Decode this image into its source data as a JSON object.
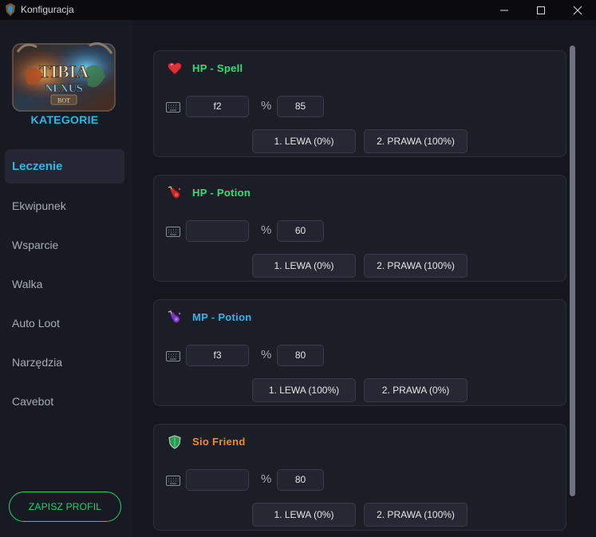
{
  "window": {
    "title": "Konfiguracja"
  },
  "sidebar": {
    "logo_text": [
      "TIBIA",
      "NEXUS",
      "BOT"
    ],
    "heading": "KATEGORIE",
    "items": [
      {
        "label": "Leczenie",
        "active": true
      },
      {
        "label": "Ekwipunek",
        "active": false
      },
      {
        "label": "Wsparcie",
        "active": false
      },
      {
        "label": "Walka",
        "active": false
      },
      {
        "label": "Auto Loot",
        "active": false
      },
      {
        "label": "Narzędzia",
        "active": false
      },
      {
        "label": "Cavebot",
        "active": false
      }
    ],
    "save_label": "ZAPISZ PROFIL"
  },
  "colors": {
    "accent_blue": "#2bb8e6",
    "green": "#27d06a",
    "hp_title": "#2fe07a",
    "mp_title": "#2bb8e6",
    "sio_title": "#f08a2a"
  },
  "cards": [
    {
      "title": "HP - Spell",
      "icon": "heart-icon",
      "hotkey": "f2",
      "percent_symbol": "%",
      "percent": "85",
      "left_button": "1. LEWA (0%)",
      "right_button": "2. PRAWA (100%)"
    },
    {
      "title": "HP - Potion",
      "icon": "health-potion-icon",
      "hotkey": "",
      "percent_symbol": "%",
      "percent": "60",
      "left_button": "1. LEWA (0%)",
      "right_button": "2. PRAWA (100%)"
    },
    {
      "title": "MP - Potion",
      "icon": "mana-potion-icon",
      "hotkey": "f3",
      "percent_symbol": "%",
      "percent": "80",
      "left_button": "1. LEWA (100%)",
      "right_button": "2. PRAWA (0%)"
    },
    {
      "title": "Sio Friend",
      "icon": "shield-icon",
      "hotkey": "",
      "percent_symbol": "%",
      "percent": "80",
      "left_button": "1. LEWA (0%)",
      "right_button": "2. PRAWA (100%)"
    }
  ]
}
